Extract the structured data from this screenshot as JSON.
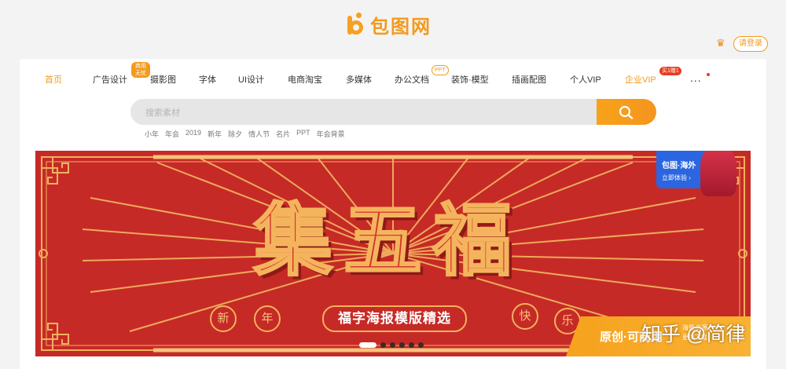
{
  "brand": {
    "name": "包图网",
    "color": "#f39a1d"
  },
  "header": {
    "crown_icon": "crown-icon",
    "login_label": "请登录"
  },
  "nav": {
    "items": [
      {
        "label": "首页",
        "active": true
      },
      {
        "label": "广告设计"
      },
      {
        "label": "摄影图"
      },
      {
        "label": "字体"
      },
      {
        "label": "UI设计"
      },
      {
        "label": "电商淘宝"
      },
      {
        "label": "多媒体"
      },
      {
        "label": "办公文档"
      },
      {
        "label": "装饰·模型"
      },
      {
        "label": "插画配图"
      },
      {
        "label": "个人VIP"
      },
      {
        "label": "企业VIP"
      }
    ],
    "tags": {
      "ad_design": "商用无忧",
      "office": "PPT",
      "enterprise": "买1赠1"
    },
    "more_label": "..."
  },
  "search": {
    "placeholder": "搜索素材",
    "button_icon": "search-icon",
    "hot_words": [
      "小年",
      "年会",
      "2019",
      "新年",
      "除夕",
      "情人节",
      "名片",
      "PPT",
      "年会背景"
    ]
  },
  "banner": {
    "title_chars": [
      "集",
      "五",
      "福"
    ],
    "subtitle": "福字海报模版精选",
    "side_chars": [
      "新",
      "年",
      "快",
      "乐"
    ],
    "overseas": {
      "title": "包图·海外",
      "subtitle": "立即体验 ›"
    },
    "promo": {
      "text": "原创·可商用",
      "small": "海量资源\n更快下载"
    },
    "carousel_count": 6,
    "active_slide": 1
  },
  "watermark": "知乎 @简律"
}
